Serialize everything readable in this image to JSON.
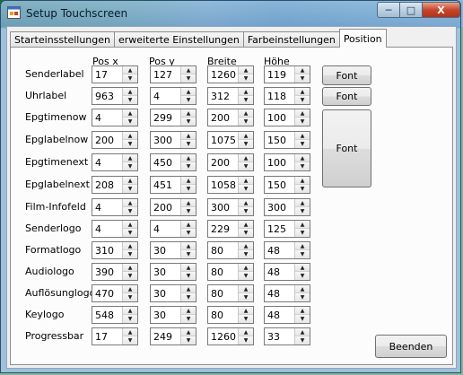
{
  "window": {
    "title": "Setup Touchscreen",
    "min_glyph": "─",
    "max_glyph": "□",
    "close_glyph": "X"
  },
  "tabs": [
    {
      "label": "Starteinsstellungen",
      "active": false
    },
    {
      "label": "erweiterte Einstellungen",
      "active": false
    },
    {
      "label": "Farbeinstellungen",
      "active": false
    },
    {
      "label": "Position",
      "active": true
    }
  ],
  "headers": {
    "x": "Pos x",
    "y": "Pos y",
    "w": "Breite",
    "h": "Höhe"
  },
  "rows": [
    {
      "label": "Senderlabel",
      "x": "17",
      "y": "127",
      "w": "1260",
      "h": "119"
    },
    {
      "label": "Uhrlabel",
      "x": "963",
      "y": "4",
      "w": "312",
      "h": "118"
    },
    {
      "label": "Epgtimenow",
      "x": "4",
      "y": "299",
      "w": "200",
      "h": "100"
    },
    {
      "label": "Epglabelnow",
      "x": "200",
      "y": "300",
      "w": "1075",
      "h": "150"
    },
    {
      "label": "Epgtimenext",
      "x": "4",
      "y": "450",
      "w": "200",
      "h": "100"
    },
    {
      "label": "Epglabelnext",
      "x": "208",
      "y": "451",
      "w": "1058",
      "h": "150"
    },
    {
      "label": "Film-Infofeld",
      "x": "4",
      "y": "200",
      "w": "300",
      "h": "300"
    },
    {
      "label": "Senderlogo",
      "x": "4",
      "y": "4",
      "w": "229",
      "h": "125"
    },
    {
      "label": "Formatlogo",
      "x": "310",
      "y": "30",
      "w": "80",
      "h": "48"
    },
    {
      "label": "Audiologo",
      "x": "390",
      "y": "30",
      "w": "80",
      "h": "48"
    },
    {
      "label": "Auflösunglogo",
      "x": "470",
      "y": "30",
      "w": "80",
      "h": "48"
    },
    {
      "label": "Keylogo",
      "x": "548",
      "y": "30",
      "w": "80",
      "h": "48"
    },
    {
      "label": "Progressbar",
      "x": "17",
      "y": "249",
      "w": "1260",
      "h": "33"
    }
  ],
  "buttons": {
    "font1": "Font",
    "font2": "Font",
    "font3": "Font",
    "beenden": "Beenden"
  },
  "icons": {
    "up": "▲",
    "down": "▼"
  }
}
